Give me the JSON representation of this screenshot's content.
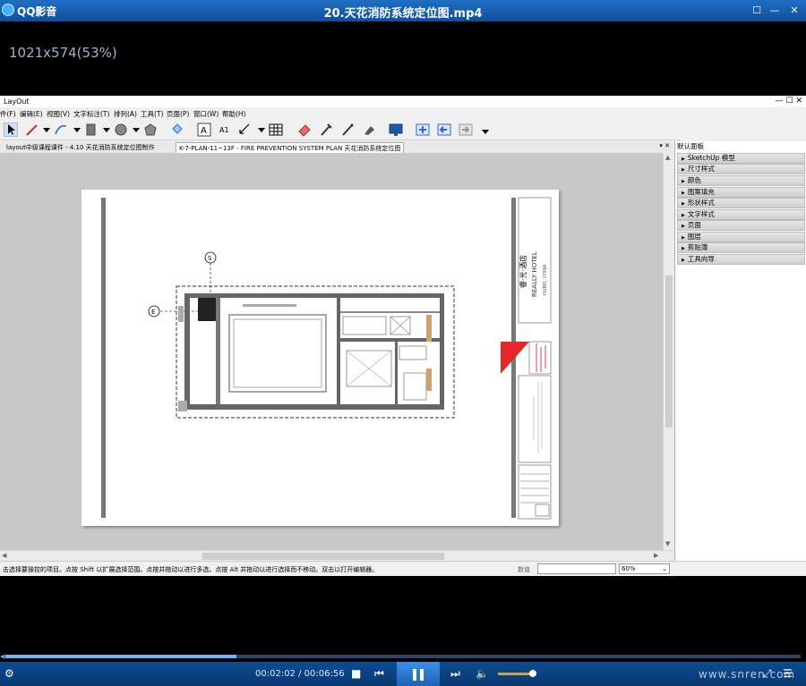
{
  "player": {
    "app_name": "QQ影音",
    "file_name": "20.天花消防系统定位图.mp4",
    "resolution": "1021x574(53%)",
    "time": "00:02:02 / 00:06:56",
    "progress": 0.29,
    "volume": 0.85,
    "watermark": "www.snren.com"
  },
  "layout": {
    "window_title": "LayOut",
    "menus": [
      "件(F)",
      "编辑(E)",
      "视图(V)",
      "文字标注(T)",
      "排列(A)",
      "工具(T)",
      "页面(P)",
      "窗口(W)",
      "帮助(H)"
    ],
    "tabs": [
      {
        "label": "layout中级课程课件 - 4.10 天花消防系统定位图制作",
        "active": false
      },
      {
        "label": "K-7-PLAN-11~13F - FIRE PREVENTION SYSTEM PLAN 天花消防系统定位图",
        "active": true
      }
    ],
    "panel_title": "默认面板",
    "panel_items": [
      "SketchUp 模型",
      "尺寸样式",
      "颜色",
      "图案填充",
      "形状样式",
      "文字样式",
      "页面",
      "图层",
      "剪贴簿",
      "工具向导"
    ],
    "status_text": "击选择要操控的项目。点按 Shift 以扩展选择范围。点按并拖动以进行多选。点按 Alt 并拖动以进行选择而不移动。双击以打开编辑器。",
    "measure_label": "数值",
    "zoom_value": "60%"
  },
  "drawing": {
    "grid_top": "S",
    "grid_left": "E",
    "hotel_cn": "睿·光·酒店",
    "hotel_en": "REALLY HOTEL",
    "location": "HUBEI, CHINA"
  }
}
